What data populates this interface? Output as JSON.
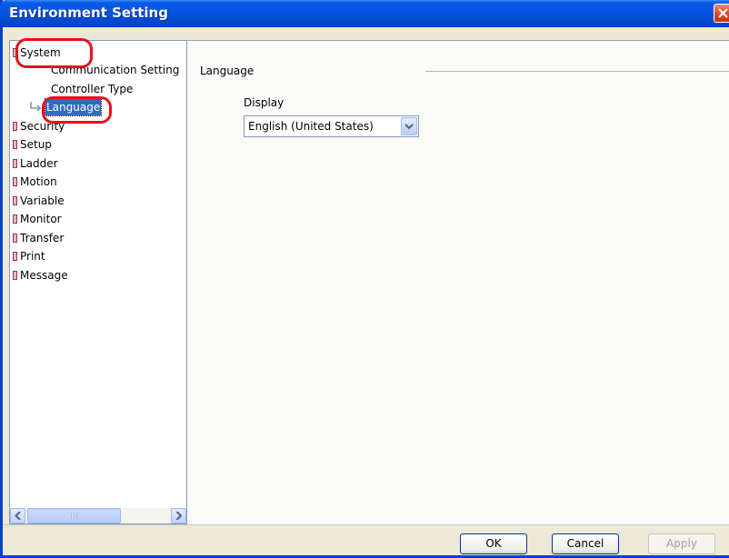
{
  "window": {
    "title": "Environment Setting"
  },
  "tree": {
    "items": [
      {
        "label": "System"
      },
      {
        "label": "Communication Setting"
      },
      {
        "label": "Controller Type"
      },
      {
        "label": "Language",
        "selected": true
      },
      {
        "label": "Security"
      },
      {
        "label": "Setup"
      },
      {
        "label": "Ladder"
      },
      {
        "label": "Motion"
      },
      {
        "label": "Variable"
      },
      {
        "label": "Monitor"
      },
      {
        "label": "Transfer"
      },
      {
        "label": "Print"
      },
      {
        "label": "Message"
      }
    ]
  },
  "panel": {
    "group_title": "Language",
    "display_label": "Display",
    "display_value": "English (United States)"
  },
  "buttons": {
    "ok": "OK",
    "cancel": "Cancel",
    "apply": "Apply"
  },
  "colors": {
    "titlebar": "#0453dc",
    "selection": "#316ac5",
    "annotation": "#e8101a"
  }
}
